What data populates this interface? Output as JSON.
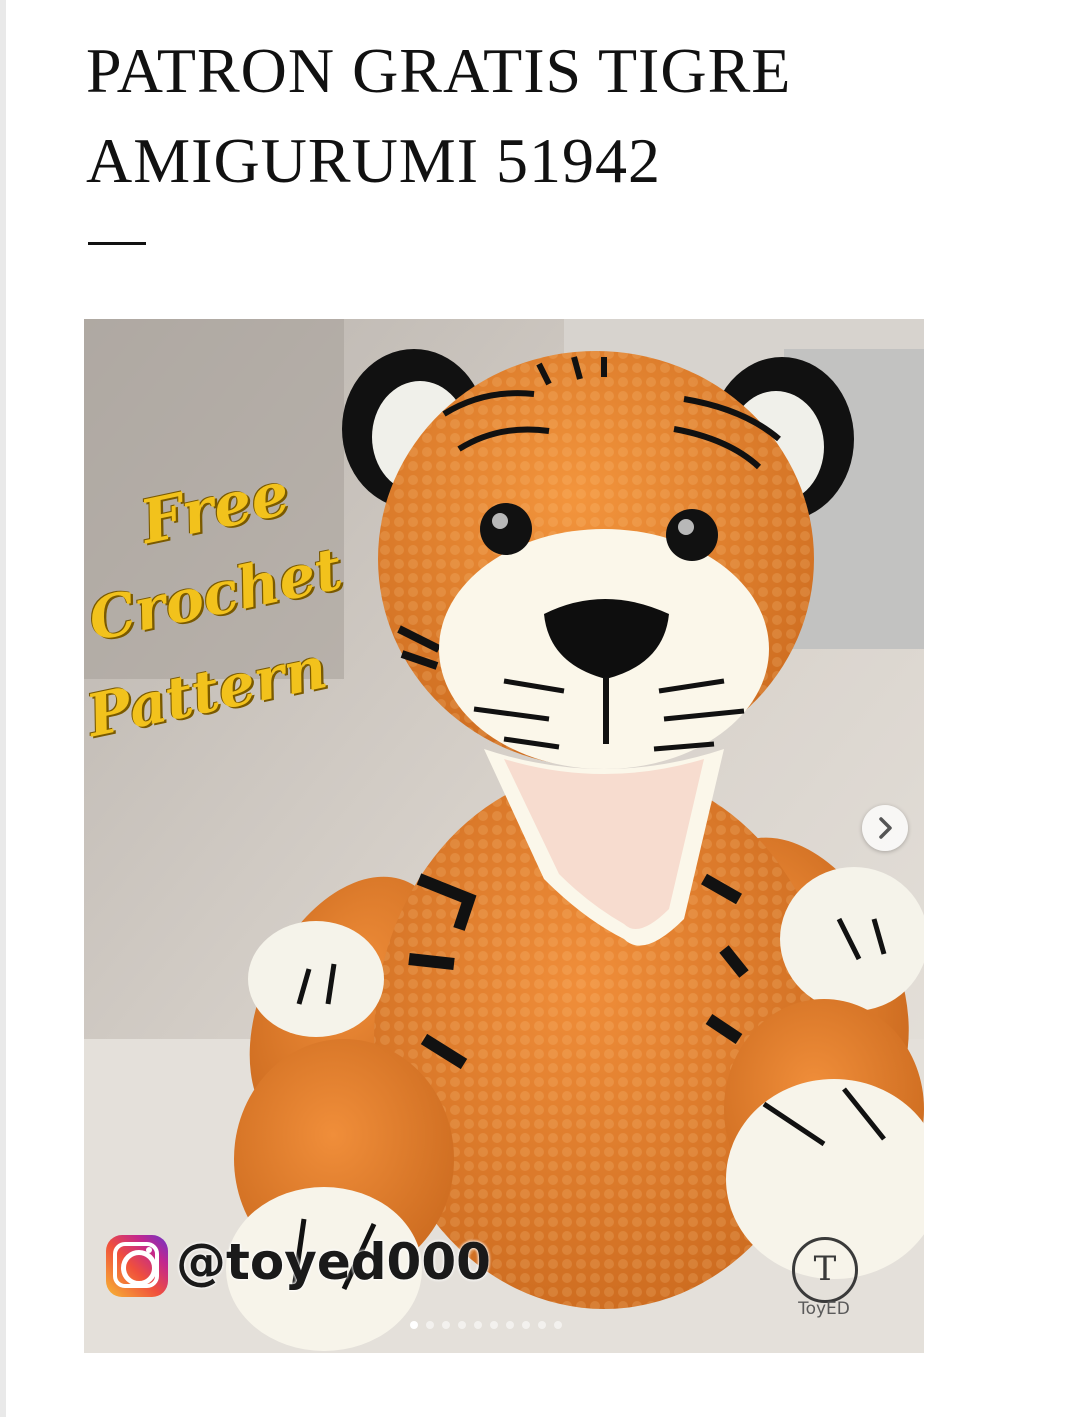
{
  "post": {
    "title": "PATRON GRATIS TIGRE AMIGURUMI 51942"
  },
  "image": {
    "promo_lines": [
      "Free",
      "Crochet",
      "Pattern"
    ],
    "instagram_handle": "@toyed000",
    "brand_logo_letter": "T",
    "brand_name": "ToyED",
    "icons": {
      "instagram": "instagram-icon",
      "next": "chevron-right-icon"
    },
    "carousel": {
      "total": 10,
      "active_index": 0
    }
  },
  "colors": {
    "title": "#111111",
    "promo_text": "#f2c21c",
    "tiger_orange": "#e2822f",
    "tiger_white": "#fbf7ea",
    "tiger_black": "#111111"
  }
}
